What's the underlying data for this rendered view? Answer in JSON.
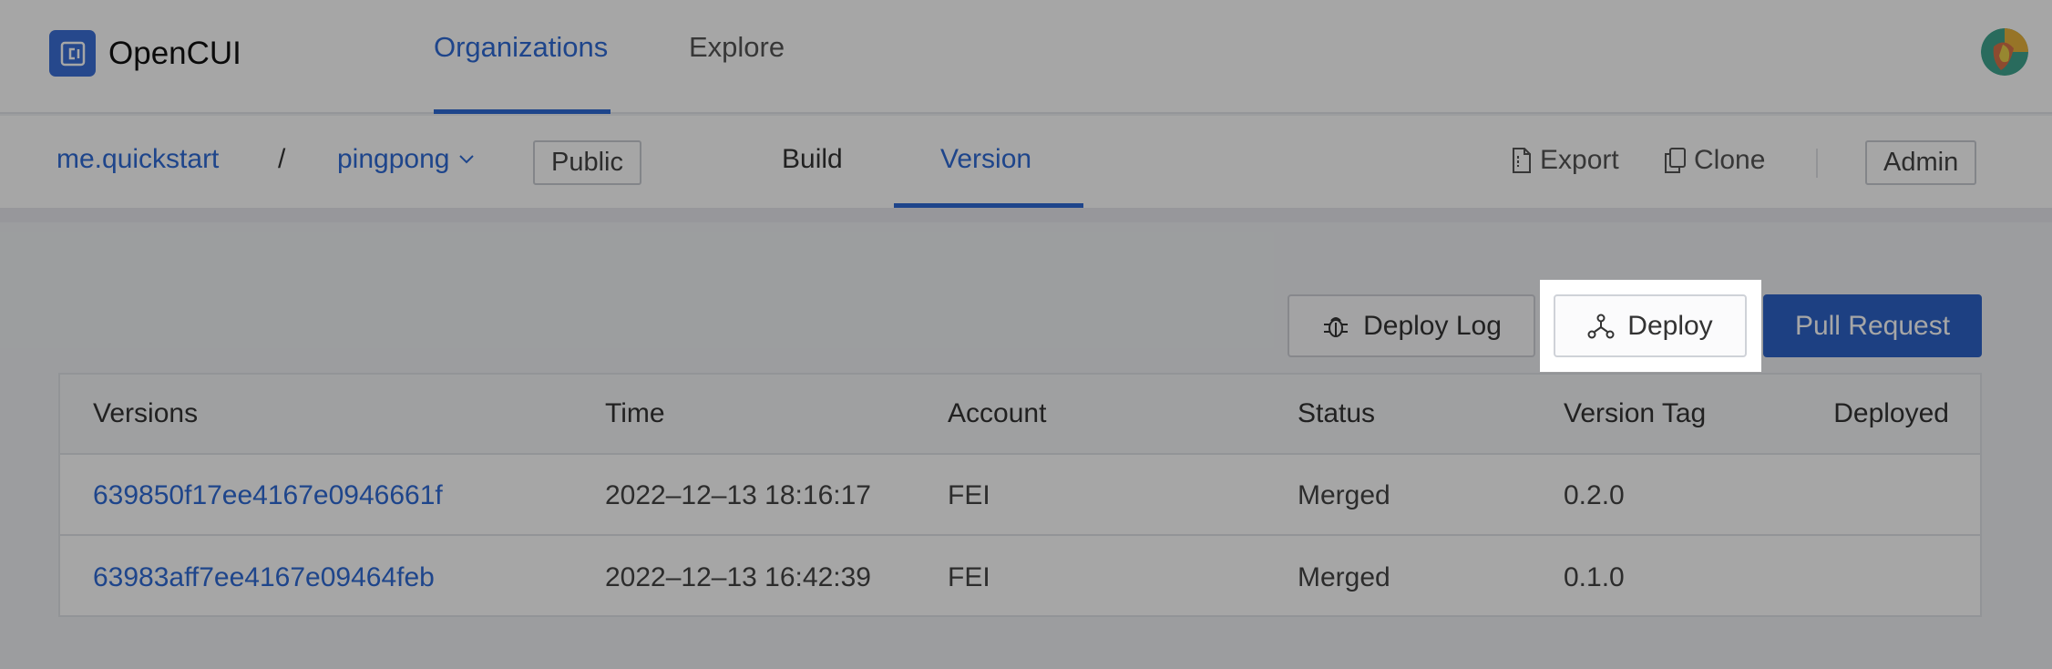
{
  "app": {
    "name": "OpenCUI"
  },
  "topnav": {
    "tabs": [
      {
        "label": "Organizations"
      },
      {
        "label": "Explore"
      }
    ]
  },
  "breadcrumb": {
    "org": "me.quickstart",
    "separator": "/",
    "project": "pingpong"
  },
  "visibility_badge": "Public",
  "subtabs": [
    {
      "label": "Build"
    },
    {
      "label": "Version"
    }
  ],
  "actions": {
    "export": "Export",
    "clone": "Clone",
    "admin": "Admin"
  },
  "buttons": {
    "deploy_log": "Deploy Log",
    "deploy": "Deploy",
    "pull_request": "Pull Request"
  },
  "table": {
    "headers": {
      "versions": "Versions",
      "time": "Time",
      "account": "Account",
      "status": "Status",
      "version_tag": "Version Tag",
      "deployed": "Deployed"
    },
    "rows": [
      {
        "version": "639850f17ee4167e0946661f",
        "time": "2022–12–13 18:16:17",
        "account": "FEI",
        "status": "Merged",
        "version_tag": "0.2.0",
        "deployed": ""
      },
      {
        "version": "63983aff7ee4167e09464feb",
        "time": "2022–12–13 16:42:39",
        "account": "FEI",
        "status": "Merged",
        "version_tag": "0.1.0",
        "deployed": ""
      }
    ]
  },
  "colors": {
    "accent": "#2f6bd6",
    "primary_button": "#2d63c8",
    "logo": "#3b6fd8"
  }
}
